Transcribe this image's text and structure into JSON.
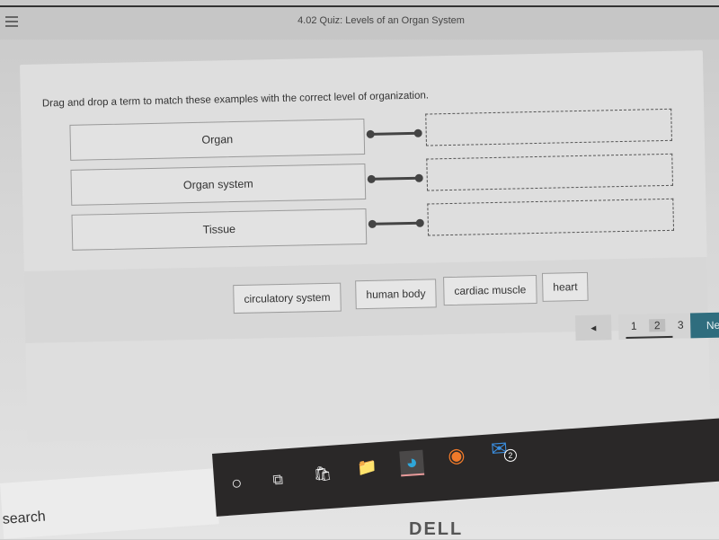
{
  "header": {
    "menu_icon": "hamburger-menu-icon",
    "title": "4.02 Quiz: Levels of an Organ System"
  },
  "question": {
    "instruction": "Drag and drop a term to match these examples with the correct level of organization.",
    "rows": [
      {
        "label": "Organ",
        "answer": ""
      },
      {
        "label": "Organ system",
        "answer": ""
      },
      {
        "label": "Tissue",
        "answer": ""
      }
    ],
    "term_bank": [
      "circulatory system",
      "human body",
      "cardiac muscle",
      "heart"
    ]
  },
  "pagination": {
    "prev_icon": "◂",
    "pages": [
      "1",
      "2",
      "3"
    ],
    "current_page": "2",
    "next_label": "Next"
  },
  "taskbar": {
    "search_label": "search",
    "icons": [
      {
        "name": "cortana-icon",
        "glyph": "○"
      },
      {
        "name": "task-view-icon",
        "glyph": "⧉"
      },
      {
        "name": "microsoft-store-icon",
        "glyph": "🛍"
      },
      {
        "name": "file-explorer-icon",
        "glyph": "📁"
      },
      {
        "name": "edge-browser-icon",
        "glyph": "◕"
      },
      {
        "name": "firefox-icon",
        "glyph": "◉"
      },
      {
        "name": "mail-icon",
        "glyph": "✉"
      }
    ],
    "mail_badge": "2"
  },
  "device": {
    "brand": "DELL"
  }
}
